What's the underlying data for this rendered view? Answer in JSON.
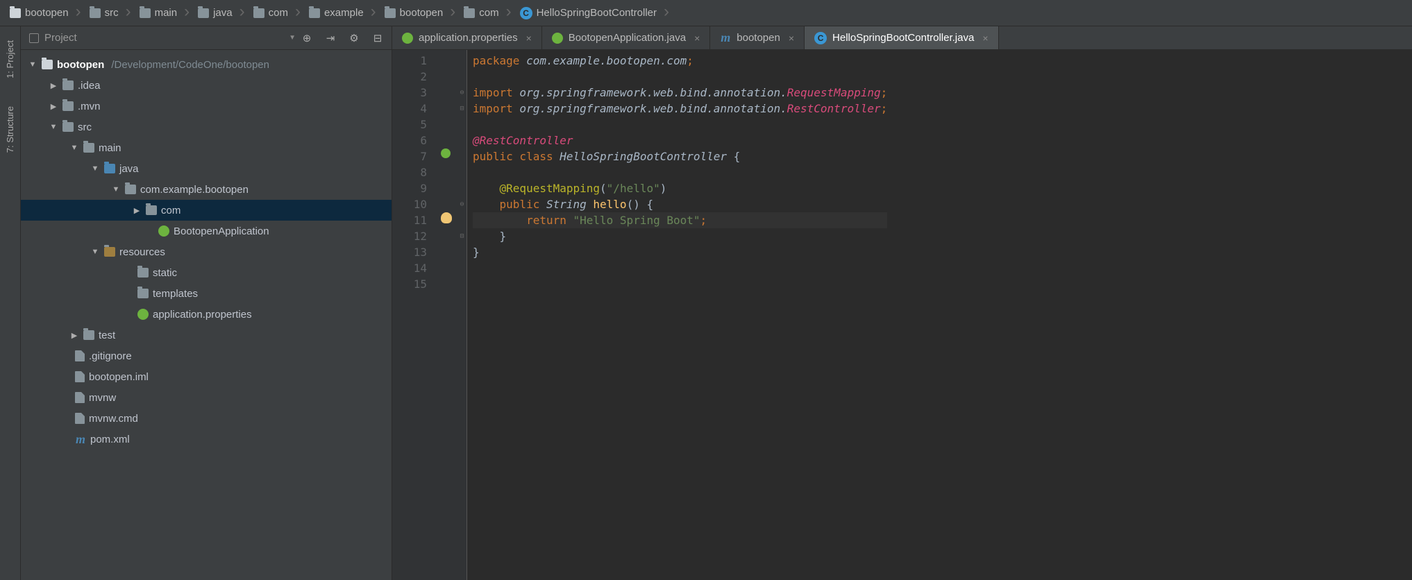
{
  "breadcrumbs": [
    {
      "label": "bootopen",
      "icon": "folder-root"
    },
    {
      "label": "src",
      "icon": "folder"
    },
    {
      "label": "main",
      "icon": "folder"
    },
    {
      "label": "java",
      "icon": "folder"
    },
    {
      "label": "com",
      "icon": "folder"
    },
    {
      "label": "example",
      "icon": "folder"
    },
    {
      "label": "bootopen",
      "icon": "folder"
    },
    {
      "label": "com",
      "icon": "folder"
    },
    {
      "label": "HelloSpringBootController",
      "icon": "class"
    }
  ],
  "left_gutter": {
    "project": "1: Project",
    "structure": "7: Structure"
  },
  "project_panel": {
    "title": "Project",
    "root": {
      "name": "bootopen",
      "path": "/Development/CodeOne/bootopen"
    },
    "tree": {
      "idea": ".idea",
      "mvn": ".mvn",
      "src": "src",
      "main": "main",
      "java": "java",
      "pkg": "com.example.bootopen",
      "com": "com",
      "app": "BootopenApplication",
      "resources": "resources",
      "static": "static",
      "templates": "templates",
      "appprops": "application.properties",
      "test": "test",
      "gitignore": ".gitignore",
      "iml": "bootopen.iml",
      "mvnw": "mvnw",
      "mvnwcmd": "mvnw.cmd",
      "pom": "pom.xml"
    }
  },
  "tabs": [
    {
      "label": "application.properties",
      "icon": "spring",
      "active": false
    },
    {
      "label": "BootopenApplication.java",
      "icon": "spring-class",
      "active": false
    },
    {
      "label": "bootopen",
      "icon": "maven",
      "active": false
    },
    {
      "label": "HelloSpringBootController.java",
      "icon": "class",
      "active": true
    }
  ],
  "editor": {
    "lines": [
      "1",
      "2",
      "3",
      "4",
      "5",
      "6",
      "7",
      "8",
      "9",
      "10",
      "11",
      "12",
      "13",
      "14",
      "15"
    ],
    "code": {
      "l1": {
        "kw": "package",
        "pkg": " com.example.bootopen.com",
        "end": ";"
      },
      "l3": {
        "kw": "import",
        "pkg": " org.springframework.web.bind.annotation.",
        "cls": "RequestMapping",
        "end": ";"
      },
      "l4": {
        "kw": "import",
        "pkg": " org.springframework.web.bind.annotation.",
        "cls": "RestController",
        "end": ";"
      },
      "l6": {
        "ann": "@RestController"
      },
      "l7": {
        "kw": "public class",
        "cls": " HelloSpringBootController",
        "brace": " {"
      },
      "l9": {
        "ann": "@RequestMapping",
        "paren": "(",
        "str": "\"/hello\"",
        "paren2": ")"
      },
      "l10": {
        "kw": "public",
        "type": " String",
        "id": " hello",
        "rest": "() {"
      },
      "l11": {
        "kw": "return",
        "str": " \"Hello Spring Boot\"",
        "end": ";"
      },
      "l12": {
        "brace": "}"
      },
      "l13": {
        "brace": "}"
      }
    }
  }
}
